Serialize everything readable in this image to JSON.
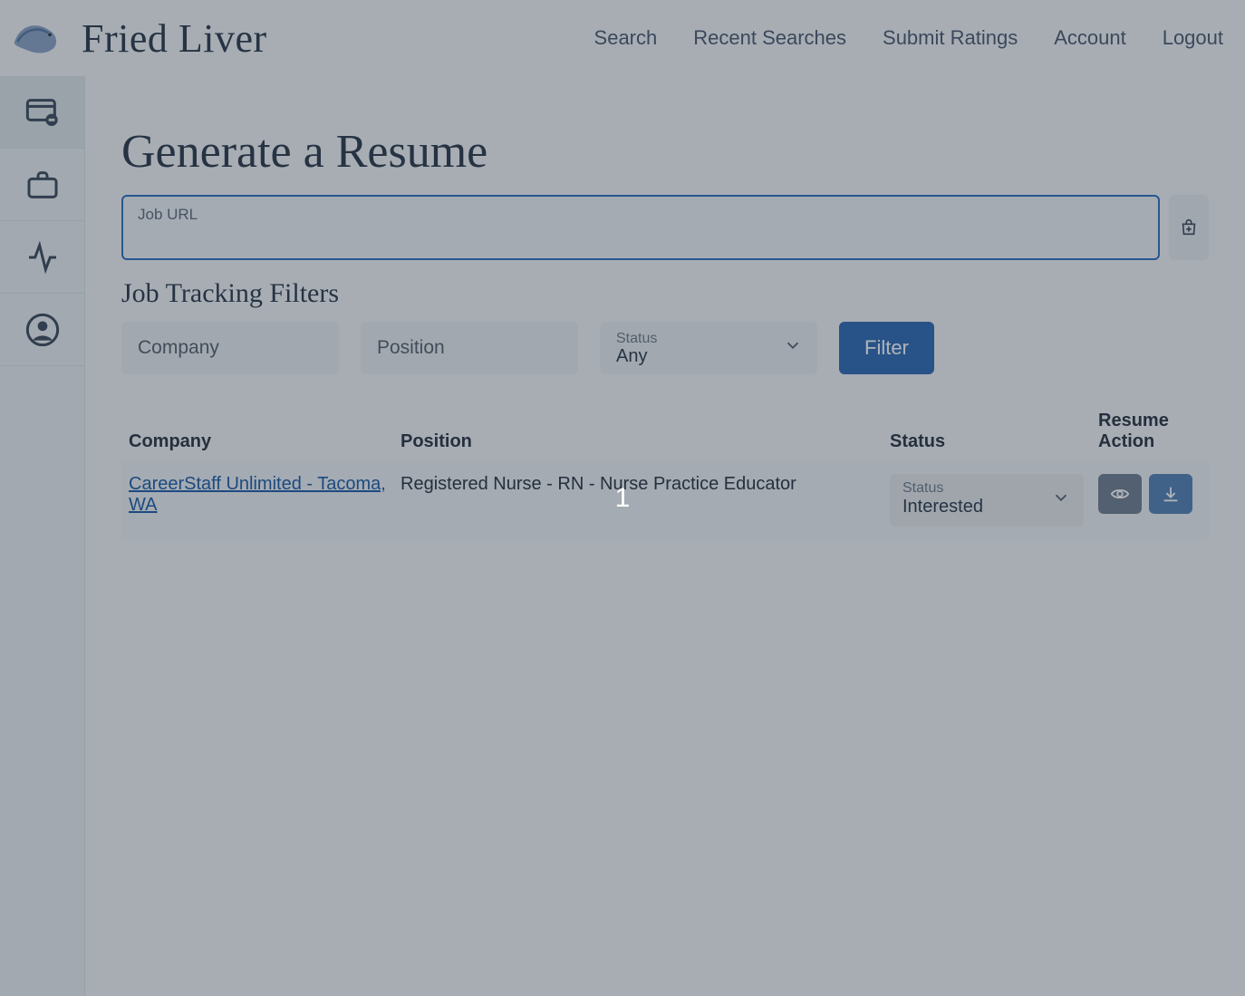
{
  "header": {
    "brand": "Fried Liver",
    "nav": [
      "Search",
      "Recent Searches",
      "Submit Ratings",
      "Account",
      "Logout"
    ]
  },
  "sidebar": {
    "items": [
      {
        "name": "resume-generator",
        "active": true
      },
      {
        "name": "jobs",
        "active": false
      },
      {
        "name": "activity",
        "active": false
      },
      {
        "name": "profile",
        "active": false
      }
    ]
  },
  "page": {
    "title": "Generate a Resume",
    "job_url_label": "Job URL",
    "job_url_value": "",
    "filters_title": "Job Tracking Filters",
    "filter_button": "Filter"
  },
  "filters": {
    "company": {
      "label": "Company",
      "value": ""
    },
    "position": {
      "label": "Position",
      "value": ""
    },
    "status": {
      "label": "Status",
      "value": "Any"
    }
  },
  "table": {
    "columns": [
      "Company",
      "Position",
      "Status",
      "Resume Action"
    ],
    "rows": [
      {
        "company": "CareerStaff Unlimited - Tacoma, WA",
        "position": "Registered Nurse - RN - Nurse Practice Educator",
        "status_label": "Status",
        "status_value": "Interested"
      }
    ]
  },
  "overlay_number": "1"
}
